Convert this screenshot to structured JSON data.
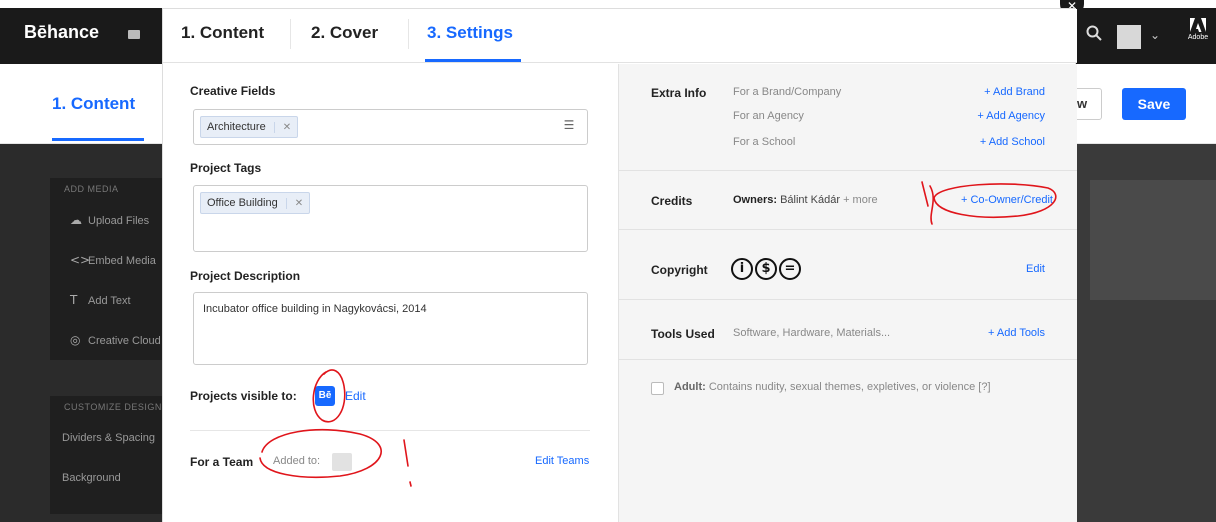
{
  "topbar": {
    "logo": "Bēhance",
    "adobe_label": "Adobe"
  },
  "subbar": {
    "tab_label": "1. Content",
    "preview_label": "w",
    "save_label": "Save"
  },
  "sidebar": {
    "add_media_heading": "ADD MEDIA",
    "media_items": [
      {
        "icon": "cloud-upload-icon",
        "glyph": "☁",
        "label": "Upload Files"
      },
      {
        "icon": "embed-icon",
        "glyph": "<>",
        "label": "Embed Media"
      },
      {
        "icon": "text-icon",
        "glyph": "T",
        "label": "Add Text"
      },
      {
        "icon": "creative-cloud-icon",
        "glyph": "◎",
        "label": "Creative Cloud"
      }
    ],
    "customize_heading": "CUSTOMIZE DESIGN",
    "customize_items": [
      {
        "label": "Dividers & Spacing"
      },
      {
        "label": "Background"
      }
    ]
  },
  "modal": {
    "tabs": [
      {
        "label": "1. Content",
        "active": false
      },
      {
        "label": "2. Cover",
        "active": false
      },
      {
        "label": "3. Settings",
        "active": true
      }
    ],
    "creative_fields": {
      "label": "Creative Fields",
      "tags": [
        "Architecture"
      ]
    },
    "project_tags": {
      "label": "Project Tags",
      "tags": [
        "Office Building"
      ]
    },
    "project_description": {
      "label": "Project Description",
      "value": "Incubator office building in Nagykovácsi, 2014"
    },
    "visibility": {
      "label": "Projects visible to:",
      "badge": "Bē",
      "edit_label": "Edit"
    },
    "team": {
      "label": "For a Team",
      "added_to": "Added to:",
      "edit_label": "Edit Teams"
    }
  },
  "extra_info": {
    "label": "Extra Info",
    "rows": [
      {
        "text": "For a Brand/Company",
        "action": "+ Add Brand"
      },
      {
        "text": "For an Agency",
        "action": "+ Add Agency"
      },
      {
        "text": "For a School",
        "action": "+ Add School"
      }
    ]
  },
  "credits": {
    "label": "Credits",
    "owners_label": "Owners:",
    "owner_name": "Bálint Kádár",
    "more": "+ more",
    "action": "+ Co-Owner/Credit"
  },
  "copyright": {
    "label": "Copyright",
    "icons": [
      "attribution-icon",
      "noncommercial-icon",
      "no-derivatives-icon"
    ],
    "edit_label": "Edit"
  },
  "tools": {
    "label": "Tools Used",
    "placeholder": "Software, Hardware, Materials...",
    "action": "+ Add Tools"
  },
  "adult": {
    "label": "Adult:",
    "text": "Contains nudity, sexual themes, expletives, or violence [?]"
  },
  "colors": {
    "accent": "#1769ff",
    "annotation": "#e0151b"
  }
}
